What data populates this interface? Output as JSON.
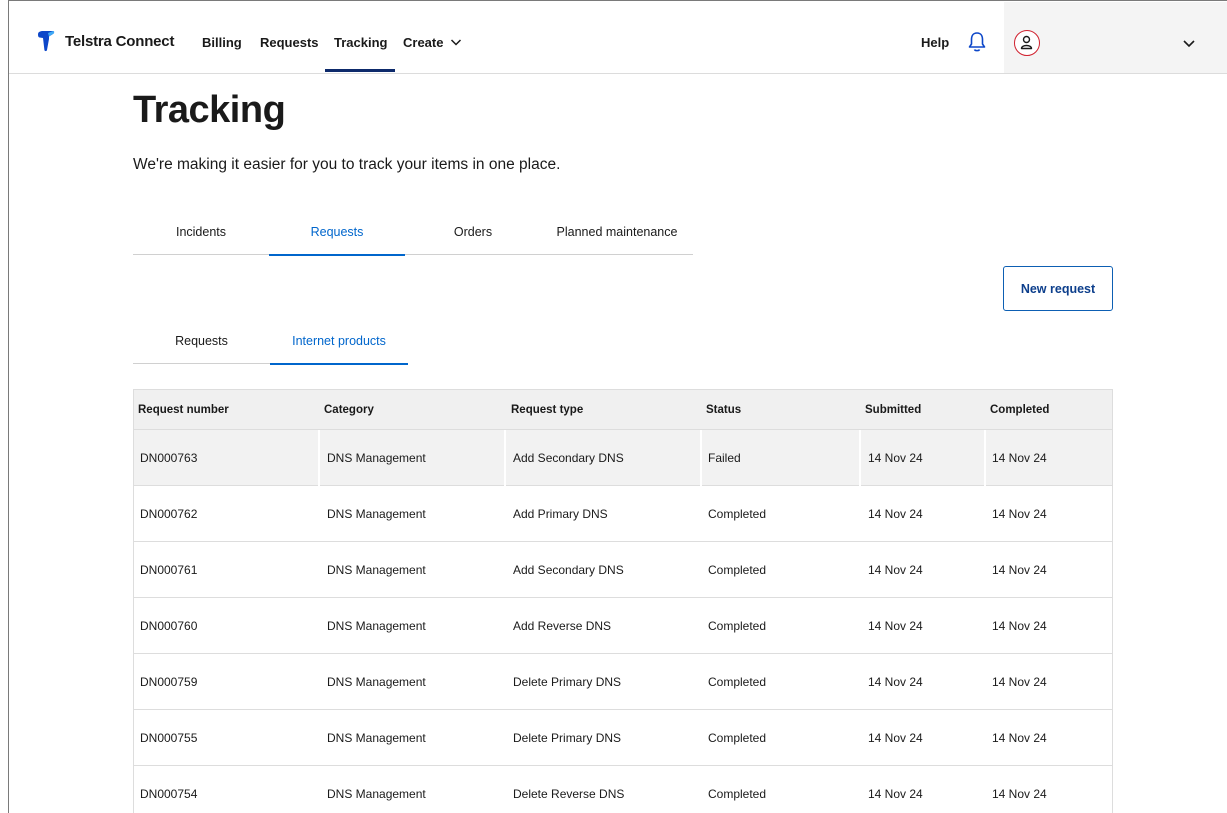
{
  "nav": {
    "brand": "Telstra Connect",
    "links": [
      "Billing",
      "Requests",
      "Tracking",
      "Create"
    ],
    "help": "Help"
  },
  "page": {
    "title": "Tracking",
    "subtitle": "We're making it easier for you to track your items in one place."
  },
  "tabs_primary": [
    "Incidents",
    "Requests",
    "Orders",
    "Planned maintenance"
  ],
  "tabs_primary_active": "Requests",
  "new_request_label": "New request",
  "tabs_secondary": [
    "Requests",
    "Internet products"
  ],
  "tabs_secondary_active": "Internet products",
  "table": {
    "headers": [
      "Request number",
      "Category",
      "Request type",
      "Status",
      "Submitted",
      "Completed"
    ],
    "rows": [
      [
        "DN000763",
        "DNS Management",
        "Add Secondary DNS",
        "Failed",
        "14 Nov 24",
        "14 Nov 24"
      ],
      [
        "DN000762",
        "DNS Management",
        "Add Primary DNS",
        "Completed",
        "14 Nov 24",
        "14 Nov 24"
      ],
      [
        "DN000761",
        "DNS Management",
        "Add Secondary DNS",
        "Completed",
        "14 Nov 24",
        "14 Nov 24"
      ],
      [
        "DN000760",
        "DNS Management",
        "Add Reverse DNS",
        "Completed",
        "14 Nov 24",
        "14 Nov 24"
      ],
      [
        "DN000759",
        "DNS Management",
        "Delete Primary DNS",
        "Completed",
        "14 Nov 24",
        "14 Nov 24"
      ],
      [
        "DN000755",
        "DNS Management",
        "Delete Primary DNS",
        "Completed",
        "14 Nov 24",
        "14 Nov 24"
      ],
      [
        "DN000754",
        "DNS Management",
        "Delete Reverse DNS",
        "Completed",
        "14 Nov 24",
        "14 Nov 24"
      ]
    ]
  },
  "colors": {
    "brand_blue": "#0066cc",
    "nav_active": "#0d2a6b",
    "avatar_ring": "#d0202e"
  },
  "icons": [
    "telstra-logo-icon",
    "chevron-down-icon",
    "bell-icon",
    "user-icon"
  ]
}
